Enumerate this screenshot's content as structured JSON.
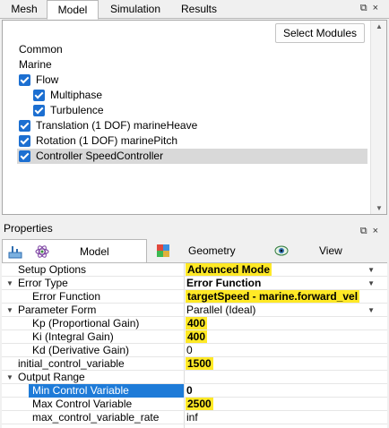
{
  "top_tabs": [
    {
      "label": "Mesh"
    },
    {
      "label": "Model"
    },
    {
      "label": "Simulation"
    },
    {
      "label": "Results"
    }
  ],
  "window_buttons": {
    "float": "⧉",
    "close": "×"
  },
  "tree": {
    "select_modules_label": "Select Modules",
    "items": [
      {
        "label": "Common",
        "checked": false
      },
      {
        "label": "Marine",
        "checked": false
      },
      {
        "label": "Flow",
        "checked": true
      },
      {
        "label": "Multiphase",
        "checked": true
      },
      {
        "label": "Turbulence",
        "checked": true
      },
      {
        "label": "Translation (1 DOF) marineHeave",
        "checked": true
      },
      {
        "label": "Rotation (1 DOF) marinePitch",
        "checked": true
      },
      {
        "label": "Controller SpeedController",
        "checked": true
      }
    ]
  },
  "properties": {
    "title": "Properties",
    "tabs": [
      {
        "label": "Model",
        "icon": "model-icon"
      },
      {
        "label": "Geometry",
        "icon": "geometry-icon"
      },
      {
        "label": "View",
        "icon": "view-icon"
      }
    ],
    "rows": [
      {
        "name": "Setup Options",
        "value": "Advanced Mode"
      },
      {
        "name": "Error Type",
        "value": "Error Function"
      },
      {
        "name": "Error Function",
        "value": "targetSpeed - marine.forward_vel"
      },
      {
        "name": "Parameter Form",
        "value": "Parallel (Ideal)"
      },
      {
        "name": "Kp (Proportional Gain)",
        "value": "400"
      },
      {
        "name": "Ki (Integral Gain)",
        "value": "400"
      },
      {
        "name": "Kd (Derivative Gain)",
        "value": "0"
      },
      {
        "name": "initial_control_variable",
        "value": "1500"
      },
      {
        "name": "Output Range",
        "value": ""
      },
      {
        "name": "Min Control Variable",
        "value": "0"
      },
      {
        "name": "Max Control Variable",
        "value": "2500"
      },
      {
        "name": "max_control_variable_rate",
        "value": "inf"
      }
    ]
  },
  "colors": {
    "highlight": "#ffe926",
    "checkbox": "#1c6fd1",
    "selection": "#1e7bd8"
  }
}
